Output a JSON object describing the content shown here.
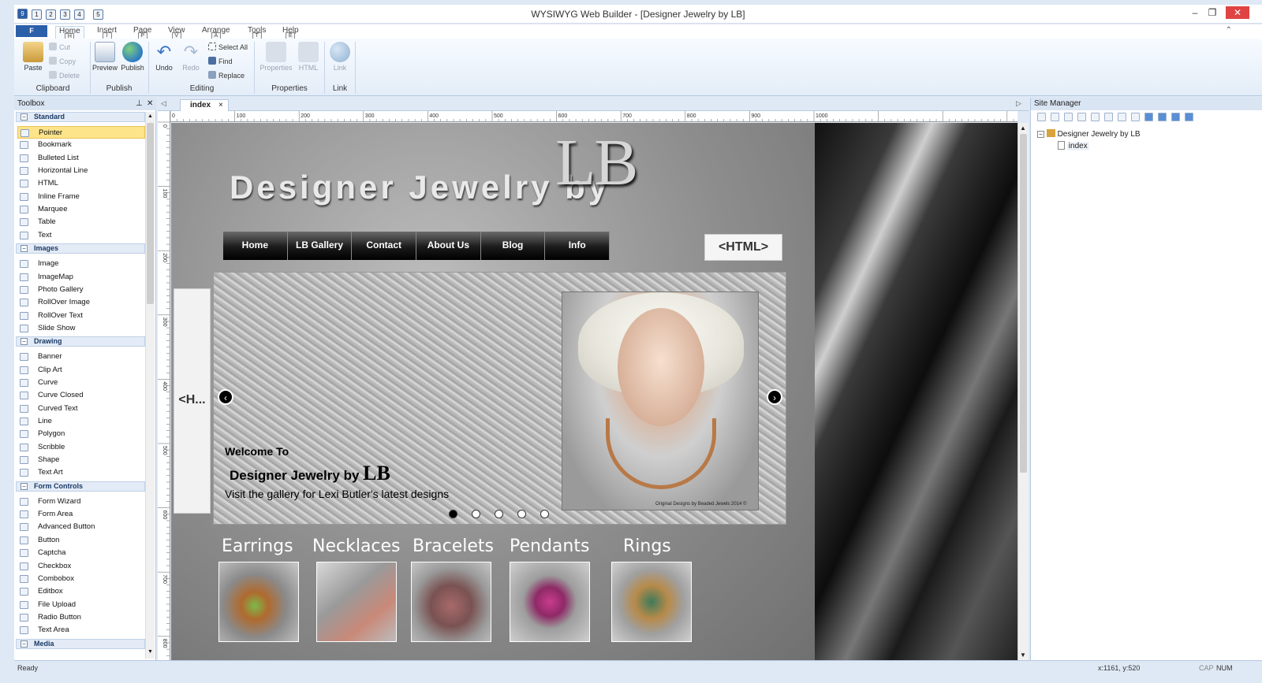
{
  "app": {
    "title": "WYSIWYG Web Builder - [Designer Jewelry by LB]"
  },
  "quick_access": [
    "1",
    "2",
    "3",
    "4",
    "5"
  ],
  "window_controls": {
    "minimize": "–",
    "restore": "❐",
    "close": "✕"
  },
  "ribbon_tabs": [
    {
      "label": "F",
      "key": ""
    },
    {
      "label": "Home",
      "key": "H"
    },
    {
      "label": "Insert",
      "key": "I"
    },
    {
      "label": "Page",
      "key": "P"
    },
    {
      "label": "View",
      "key": "V"
    },
    {
      "label": "Arrange",
      "key": "A"
    },
    {
      "label": "Tools",
      "key": "T"
    },
    {
      "label": "Help",
      "key": "E"
    }
  ],
  "ribbon": {
    "clipboard": {
      "paste": "Paste",
      "cut": "Cut",
      "copy": "Copy",
      "delete": "Delete",
      "label": "Clipboard"
    },
    "publish": {
      "preview": "Preview",
      "publish": "Publish",
      "label": "Publish"
    },
    "editing": {
      "undo": "Undo",
      "redo": "Redo",
      "select_all": "Select All",
      "find": "Find",
      "replace": "Replace",
      "label": "Editing"
    },
    "properties": {
      "properties": "Properties",
      "html": "HTML",
      "label": "Properties"
    },
    "link": {
      "link": "Link",
      "label": "Link"
    }
  },
  "toolbox": {
    "title": "Toolbox",
    "categories": [
      {
        "name": "Standard",
        "items": [
          "Pointer",
          "Bookmark",
          "Bulleted List",
          "Horizontal Line",
          "HTML",
          "Inline Frame",
          "Marquee",
          "Table",
          "Text"
        ]
      },
      {
        "name": "Images",
        "items": [
          "Image",
          "ImageMap",
          "Photo Gallery",
          "RollOver Image",
          "RollOver Text",
          "Slide Show"
        ]
      },
      {
        "name": "Drawing",
        "items": [
          "Banner",
          "Clip Art",
          "Curve",
          "Curve Closed",
          "Curved Text",
          "Line",
          "Polygon",
          "Scribble",
          "Shape",
          "Text Art"
        ]
      },
      {
        "name": "Form Controls",
        "items": [
          "Form Wizard",
          "Form Area",
          "Advanced Button",
          "Button",
          "Captcha",
          "Checkbox",
          "Combobox",
          "Editbox",
          "File Upload",
          "Radio Button",
          "Text Area"
        ]
      },
      {
        "name": "Media",
        "items": []
      }
    ]
  },
  "document_tab": {
    "label": "index",
    "close": "×"
  },
  "ruler": {
    "h": [
      "0",
      "100",
      "200",
      "300",
      "400",
      "500",
      "600",
      "700",
      "800",
      "900",
      "1000"
    ],
    "v": [
      "0",
      "100",
      "200",
      "300",
      "400",
      "500",
      "600",
      "700",
      "800"
    ]
  },
  "page": {
    "header_text": "Designer Jewelry by",
    "header_lb": "LB",
    "menu": [
      "Home",
      "LB Gallery",
      "Contact",
      "About Us",
      "Blog",
      "Info"
    ],
    "html_box": "<HTML>",
    "html_side": "<H...",
    "slide": {
      "welcome": "Welcome To",
      "title_prefix": "Designer Jewelry by",
      "title_lb": "LB",
      "subtitle": "Visit the gallery for Lexi Butler's latest designs",
      "watermark": "Original Designs by Beaded Jewels 2014 ©",
      "prev": "‹",
      "next": "›",
      "dots": [
        true,
        false,
        false,
        false,
        false
      ]
    },
    "categories": [
      "Earrings",
      "Necklaces",
      "Bracelets",
      "Pendants",
      "Rings"
    ]
  },
  "site_manager": {
    "title": "Site Manager",
    "site": "Designer Jewelry by LB",
    "page": "index"
  },
  "status": {
    "left": "Ready",
    "coords": "x:1161, y:520",
    "caps": "CAP",
    "num": "NUM"
  }
}
